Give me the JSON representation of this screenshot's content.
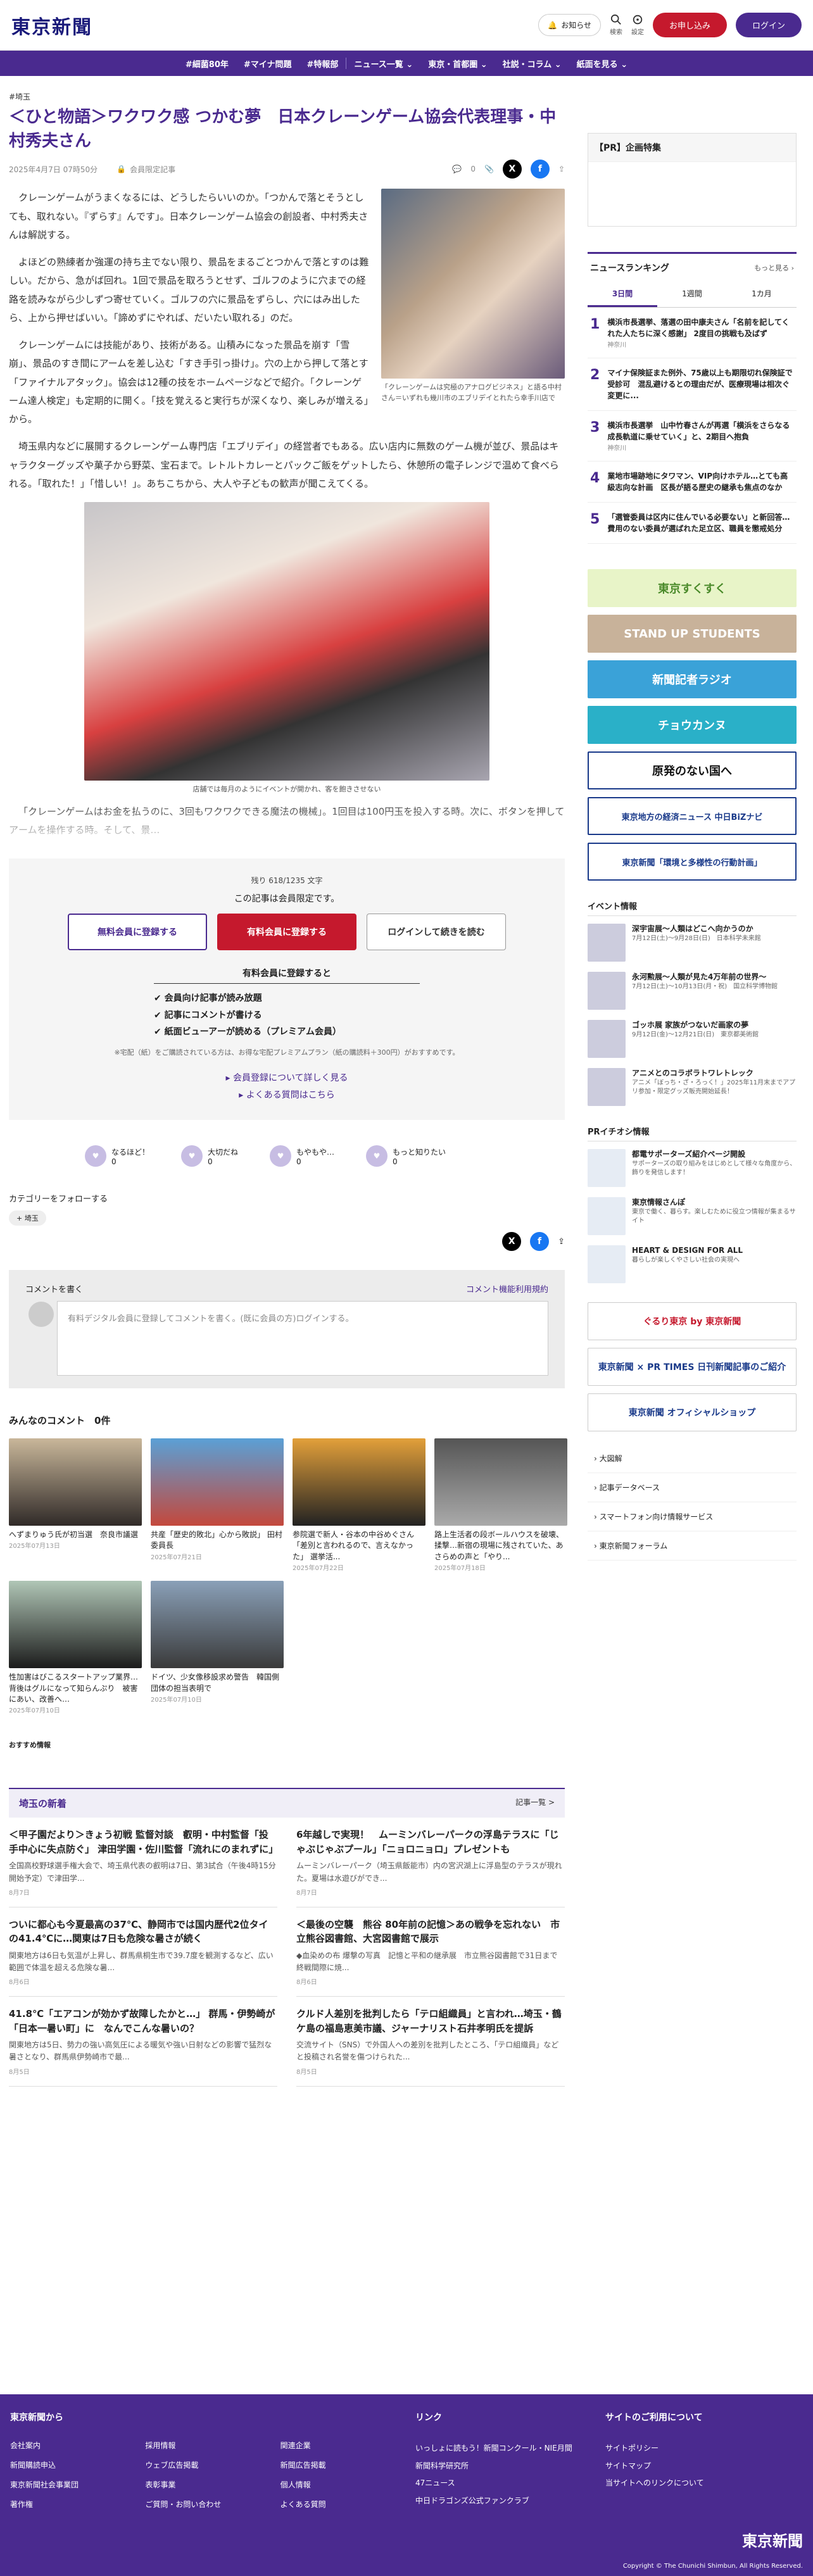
{
  "header": {
    "logo": "東京新聞",
    "notif": "お知らせ",
    "search": "検索",
    "settings": "設定",
    "apply": "お申し込み",
    "login": "ログイン"
  },
  "nav": [
    "#細菌80年",
    "#マイナ問題",
    "#特報部",
    "ニュース一覧 ⌄",
    "東京・首都圏 ⌄",
    "社説・コラム ⌄",
    "紙面を見る ⌄"
  ],
  "article": {
    "tag": "#埼玉",
    "title": "＜ひと物語＞ワクワク感 つかむ夢　日本クレーンゲーム協会代表理事・中村秀夫さん",
    "date": "2025年4月7日 07時50分",
    "lock": "会員限定記事",
    "comment_count": "0",
    "paras": [
      "クレーンゲームがうまくなるには、どうしたらいいのか。「つかんで落とそうとしても、取れない。『ずらす』んです」。日本クレーンゲーム協会の創設者、中村秀夫さんは解説する。",
      "よほどの熟練者か強運の持ち主でない限り、景品をまるごとつかんで落とすのは難しい。だから、急がば回れ。1回で景品を取ろうとせず、ゴルフのように穴までの経路を読みながら少しずつ寄せていく。ゴルフの穴に景品をずらし、穴にはみ出したら、上から押せばいい。「諦めずにやれば、だいたい取れる」のだ。",
      "クレーンゲームには技能があり、技術がある。山積みになった景品を崩す「雪崩」、景品のすき間にアームを差し込む「すき手引っ掛け」。穴の上から押して落とす「ファイナルアタック」。協会は12種の技をホームページなどで紹介。「クレーンゲーム達人検定」も定期的に開く。「技を覚えると実行ちが深くなり、楽しみが増える」から。",
      "埼玉県内などに展開するクレーンゲーム専門店「エブリデイ」の経営者でもある。広い店内に無数のゲーム機が並び、景品はキャラクターグッズや菓子から野菜、宝石まで。レトルトカレーとパックご飯をゲットしたら、休憩所の電子レンジで温めて食べられる。「取れた！」「惜しい！」。あちこちから、大人や子どもの歓声が聞こえてくる。"
    ],
    "cap1": "「クレーンゲームは究極のアナログビジネス」と語る中村さん＝いずれも幾川市のエブリデイとれたら幸手川店で",
    "cap2": "店舗では毎月のようにイベントが開かれ、客を飽きさせない",
    "fade": "「クレーンゲームはお金を払うのに、3回もワクワクできる魔法の機械」。1回目は100円玉を投入する時。次に、ボタンを押してアームを操作する時。そして、景…"
  },
  "paywall": {
    "remain": "残り 618/1235 文字",
    "limited": "この記事は会員限定です。",
    "free": "無料会員に登録する",
    "paid": "有料会員に登録する",
    "login": "ログインして続きを読む",
    "paid_head": "有料会員に登録すると",
    "benefits": [
      "会員向け記事が読み放題",
      "記事にコメントが書ける",
      "紙面ビューアーが読める（プレミアム会員）"
    ],
    "note": "※宅配（紙）をご購読されている方は、お得な宅配プレミアムプラン（紙の購読料＋300円）がおすすめです。",
    "link1": "▸ 会員登録について詳しく見る",
    "link2": "▸ よくある質問はこちら"
  },
  "reactions": [
    {
      "l": "なるほど！",
      "n": "0"
    },
    {
      "l": "大切だね",
      "n": "0"
    },
    {
      "l": "もやもや…",
      "n": "0"
    },
    {
      "l": "もっと知りたい",
      "n": "0"
    }
  ],
  "follow": {
    "head": "カテゴリーをフォローする",
    "chip": "+ 埼玉"
  },
  "comments": {
    "title": "コメントを書く",
    "rule": "コメント機能利用規約",
    "prompt": "有料デジタル会員に登録してコメントを書く。(既に会員の方)ログインする。",
    "head": "みんなのコメント　0件"
  },
  "cards": [
    {
      "t": "へずまりゅう氏が初当選　奈良市議選",
      "d": "2025年07月13日"
    },
    {
      "t": "共産「歴史的敗北」心から敗説」 田村委員長",
      "d": "2025年07月21日"
    },
    {
      "t": "参院選で新人・谷本の中谷めぐさん「差別と言われるので、言えなかった」 選挙活...",
      "d": "2025年07月22日"
    },
    {
      "t": "路上生活者の段ボールハウスを破壊、揉撃…新宿の現場に残されていた、あさらめの声と「やり...",
      "d": "2025年07月18日"
    },
    {
      "t": "性加害はびこるスタートアップ業界…背後はグルになって知らんぷり　被害にあい、改善へ…",
      "d": "2025年07月10日"
    },
    {
      "t": "ドイツ、少女像移設求め警告　韓国側団体の担当表明で",
      "d": "2025年07月10日"
    }
  ],
  "recommend": "おすすめ情報",
  "saitama": {
    "title": "埼玉の新着",
    "more": "記事一覧 >",
    "items": [
      {
        "t": "＜甲子園だより＞きょう初戦 監督対談　叡明・中村監督「投手中心に失点防ぐ」 津田学園・佐川監督「流れにのまれずに」",
        "d": "全国高校野球選手権大会で、埼玉県代表の叡明は7日、第3試合（午後4時15分開始予定）で津田学...",
        "dt": "8月7日"
      },
      {
        "t": "6年越しで実現！　ムーミンバレーパークの浮島テラスに「じゃぶじゃぶプール」「ニョロニョロ」プレゼントも",
        "d": "ムーミンバレーパーク（埼玉県飯能市）内の宮沢湖上に浮島型のテラスが現れた。夏場は水遊びができ...",
        "dt": "8月7日"
      },
      {
        "t": "ついに都心も今夏最高の37℃、静岡市では国内歴代2位タイの41.4℃に…関東は7日も危険な暑さが続く",
        "d": "関東地方は6日も気温が上昇し、群馬県桐生市で39.7度を観測するなど、広い範囲で体温を超える危険な暑...",
        "dt": "8月6日"
      },
      {
        "t": "＜最後の空襲　熊谷 80年前の記憶＞あの戦争を忘れない　市立熊谷図書館、大宮図書館で展示",
        "d": "◆血染めの布 爆撃の写真　記憶と平和の継承展　市立熊谷図書館で31日まで　終戦間際に焼...",
        "dt": "8月6日"
      },
      {
        "t": "41.8℃「エアコンが効かず故障したかと…」 群馬・伊勢崎が「日本一暑い町」に　なんでこんな暑いの？",
        "d": "関東地方は5日、勢力の強い高気圧による暖気や強い日射などの影響で猛烈な暑さとなり、群馬県伊勢崎市で最...",
        "dt": "8月5日"
      },
      {
        "t": "クルド人差別を批判したら「テロ組織員」と言われ…埼玉・鶴ケ島の福島恵美市議、ジャーナリスト石井孝明氏を提訴",
        "d": "交流サイト（SNS）で外国人への差別を批判したところ、「テロ組織員」などと投稿され名誉を傷つけられた...",
        "dt": "8月5日"
      }
    ]
  },
  "side": {
    "ad": "【PR】企画特集",
    "rank_title": "ニュースランキング",
    "more": "もっと見る ›",
    "tabs": [
      "3日間",
      "1週間",
      "1カ月"
    ],
    "ranks": [
      {
        "t": "横浜市長選挙、落選の田中康夫さん「名前を記してくれた人たちに深く感謝」 2度目の挑戦も及ばず",
        "s": "神奈川"
      },
      {
        "t": "マイナ保険証また例外、75歳以上も期限切れ保険証で受診可　混乱避けるとの理由だが、医療現場は相次ぐ変更に...",
        "s": ""
      },
      {
        "t": "横浜市長選挙　山中竹春さんが再選「横浜をさらなる成長軌道に乗せていく」と、2期目へ抱負",
        "s": "神奈川"
      },
      {
        "t": "業地市場跡地にタワマン、VIP向けホテル…とても高級志向な計画　区長が語る歴史の継承も焦点のなか",
        "s": ""
      },
      {
        "t": "「選管委員は区内に住んでいる必要ない」と新回答…費用のない委員が選ばれた足立区、職員を懲戒処分",
        "s": ""
      }
    ],
    "banners": [
      "東京すくすく",
      "STAND UP STUDENTS",
      "新聞記者ラジオ",
      "チョウカンヌ",
      "原発のない国へ",
      "東京地方の経済ニュース 中日BiZナビ",
      "東京新聞「環境と多様性の行動計画」"
    ],
    "events_head": "イベント情報",
    "events": [
      {
        "t": "深宇宙展〜人類はどこへ向かうのか",
        "d": "7月12日(土)〜9月28日(日)　日本科学未来館"
      },
      {
        "t": "永河勲展〜人類が見た4万年前の世界〜",
        "d": "7月12日(土)〜10月13日(月・祝)　国立科学博物館"
      },
      {
        "t": "ゴッホ展 家族がつないだ画家の夢",
        "d": "9月12日(金)〜12月21日(日)　東京都美術館"
      },
      {
        "t": "アニメとのコラボラトワレトレック",
        "d": "アニメ「ぼっち・ざ・ろっく！」2025年11月末までアプリ参加・限定グッズ販売開始延長！"
      }
    ],
    "pr_head": "PRイチオシ情報",
    "prs": [
      {
        "t": "都電サポーターズ紹介ページ開設",
        "d": "サポーターズの取り組みをはじめとして様々な角度から、飾りを発信します！"
      },
      {
        "t": "東京情報さんぽ",
        "d": "東京で働く、暮らす。楽しむために役立つ情報が集まるサイト"
      },
      {
        "t": "HEART & DESIGN FOR ALL",
        "d": "暮らしが楽しくやさしい社会の実現へ"
      }
    ],
    "ads2": [
      "ぐるり東京 by 東京新聞",
      "東京新聞 × PR TIMES 日刊新聞記事のご紹介",
      "東京新聞 オフィシャルショップ"
    ],
    "links": [
      "大図解",
      "記事データベース",
      "スマートフォン向け情報サービス",
      "東京新聞フォーラム"
    ]
  },
  "footer": {
    "h1": "東京新聞から",
    "h2": "リンク",
    "h3": "サイトのご利用について",
    "c1": [
      "会社案内",
      "採用情報",
      "関連企業",
      "新聞購読申込",
      "ウェブ広告掲載",
      "新聞広告掲載",
      "東京新聞社会事業団",
      "表彰事業",
      "個人情報",
      "著作権",
      "ご質問・お問い合わせ",
      "よくある質問"
    ],
    "c2": [
      "いっしょに読もう！新聞コンクール・NIE月間",
      "新聞科学研究所",
      "47ニュース",
      "中日ドラゴンズ公式ファンクラブ"
    ],
    "c3": [
      "サイトポリシー",
      "サイトマップ",
      "当サイトへのリンクについて"
    ],
    "logo": "東京新聞",
    "copy": "Copyright © The Chunichi Shimbun, All Rights Reserved."
  }
}
